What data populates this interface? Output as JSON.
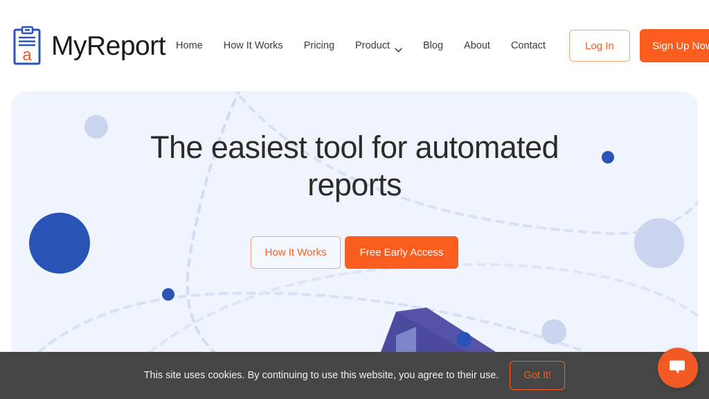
{
  "brand": {
    "name": "MyReport",
    "logo_icon": "clipboard-icon",
    "logo_letter": "a",
    "icon_color": "#2a53b8",
    "accent_color": "#fa5d1e"
  },
  "nav": {
    "links": [
      {
        "label": "Home",
        "icon": ""
      },
      {
        "label": "How It Works",
        "icon": ""
      },
      {
        "label": "Pricing",
        "icon": ""
      },
      {
        "label": "Product",
        "icon": "chevron-down-icon"
      },
      {
        "label": "Blog",
        "icon": ""
      },
      {
        "label": "About",
        "icon": ""
      },
      {
        "label": "Contact",
        "icon": ""
      }
    ],
    "login_label": "Log In",
    "signup_label": "Sign Up Now"
  },
  "hero": {
    "title": "The easiest tool for automated reports",
    "cta_secondary": "How It Works",
    "cta_primary": "Free Early Access",
    "background_color": "#f0f4fd"
  },
  "cookie": {
    "message": "This site uses cookies. By continuing to use this website, you agree to their use.",
    "accept_label": "Got It!",
    "background_color": "#464646"
  },
  "chat": {
    "icon": "chat-bubble-icon",
    "color": "#f15a24"
  }
}
